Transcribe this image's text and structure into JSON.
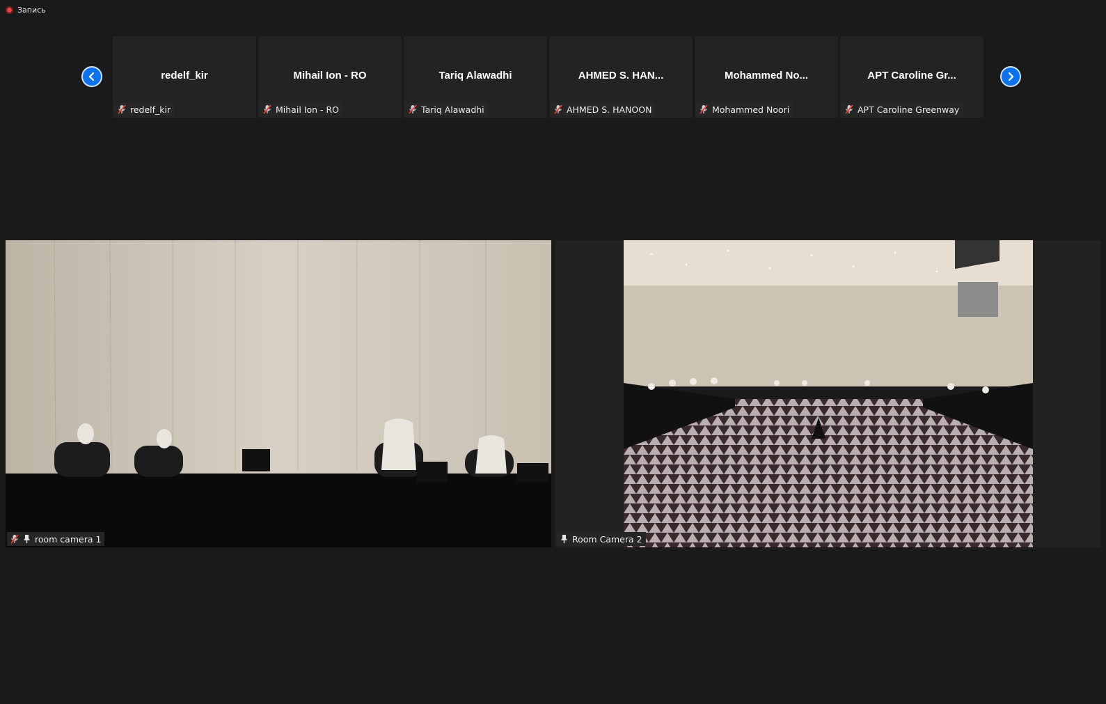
{
  "recording": {
    "label": "Запись",
    "color": "#e8453c"
  },
  "nav": {
    "prev_icon": "chevron-left-icon",
    "next_icon": "chevron-right-icon",
    "accent": "#0e72ed"
  },
  "participants": [
    {
      "display": "redelf_kir",
      "label": "redelf_kir",
      "muted": true
    },
    {
      "display": "Mihail Ion - RO",
      "label": "Mihail Ion - RO",
      "muted": true
    },
    {
      "display": "Tariq Alawadhi",
      "label": "Tariq Alawadhi",
      "muted": true
    },
    {
      "display": "AHMED S. HAN...",
      "label": "AHMED S. HANOON",
      "muted": true
    },
    {
      "display": "Mohammed No...",
      "label": "Mohammed Noori",
      "muted": true
    },
    {
      "display": "APT Caroline Gr...",
      "label": "APT Caroline Greenway",
      "muted": true
    }
  ],
  "videos": [
    {
      "label": "room camera 1",
      "muted": true,
      "pinned": true
    },
    {
      "label": "Room Camera 2",
      "muted": false,
      "pinned": true
    }
  ]
}
